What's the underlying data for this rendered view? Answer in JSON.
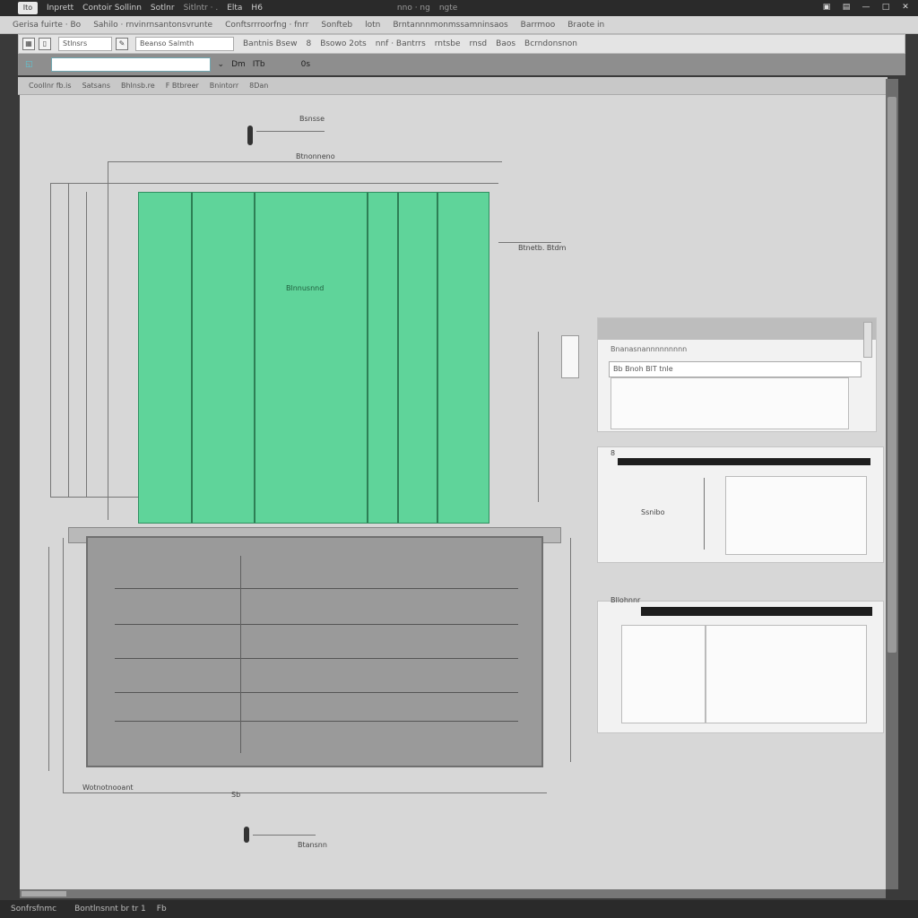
{
  "titlebar": {
    "badge": "Ito",
    "items": [
      "Inprett",
      "Contoir Sollinn",
      "Sotlnr",
      "Sitlntr  ·  .",
      "Elta",
      "H6",
      "nno  ·  ng",
      "ngte"
    ]
  },
  "toolbar1": {
    "items": [
      "Gerisa fuirte  ·  Bo",
      "Sahilo · rnvinrnsantonsvrunte",
      "Conftsrrroorfng  ·  fnrr",
      "Sonfteb",
      "lotn",
      "Brntannnmonmssamninsaos",
      "Barrmoo",
      "Braote in"
    ]
  },
  "toolbar2": {
    "field1": "Stlnsrs",
    "field2": "Beanso Salmth",
    "labels": [
      "Bantnis Bsew",
      "8",
      "Bsowo  2ots",
      "nnf  ·  Bantrrs",
      "rntsbe",
      "rnsd",
      "Baos",
      "Bcrndonsnon"
    ]
  },
  "toolbar3": {
    "search_value": "",
    "items": [
      "Dm",
      "ITb",
      "0s"
    ]
  },
  "tabrow": {
    "items": [
      "Coollnr fb.is",
      "Satsans",
      "Bhlnsb.re",
      "F  Btbreer",
      "Bnintorr",
      "8Dan"
    ]
  },
  "drawing": {
    "labels": {
      "top_dim": "Bsnsse",
      "top_dim2": "Btnonneno",
      "right_dim": "Btnetb. Btdm",
      "center_label": "Blnnusnnd",
      "bottom_left": "Wotnotnooant",
      "bottom_mark": "Sb",
      "bottom_dim": "Btansnn"
    }
  },
  "panels": {
    "p1_header": "Bnanasnannnnnnnnn",
    "p1_input": "Bb  Bnoh  BlT  tnle",
    "p2_title": "8",
    "p2_label": "Ssnibo",
    "p3_title": "Bllohnnr"
  },
  "statusbar": {
    "items": [
      "Sonfrsfnmc",
      "Bontlnsnnt br  tr  1",
      "Fb"
    ]
  }
}
